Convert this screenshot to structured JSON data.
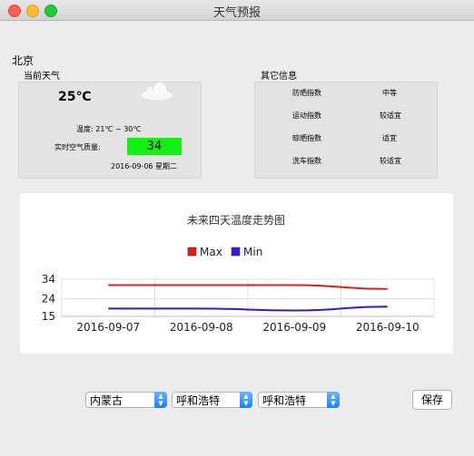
{
  "window": {
    "title": "天气预报"
  },
  "city": "北京",
  "current": {
    "label": "当前天气",
    "temp": "25℃",
    "range": "温度: 21℃ ~ 30℃",
    "aqi_label": "实时空气质量:",
    "aqi_value": "34",
    "date": "2016-09-06  星期二",
    "weather_icon": "cloud-icon"
  },
  "other": {
    "label": "其它信息",
    "items": [
      {
        "name": "防晒指数",
        "value": "中等"
      },
      {
        "name": "运动指数",
        "value": "较适宜"
      },
      {
        "name": "晾晒指数",
        "value": "适宜"
      },
      {
        "name": "洗车指数",
        "value": "较适宜"
      }
    ]
  },
  "chart_data": {
    "type": "line",
    "title": "未来四天温度走势图",
    "categories": [
      "2016-09-07",
      "2016-09-08",
      "2016-09-09",
      "2016-09-10"
    ],
    "series": [
      {
        "name": "Max",
        "color": "#e31a1c",
        "values": [
          31,
          31,
          31,
          29
        ]
      },
      {
        "name": "Min",
        "color": "#3f14d8",
        "values": [
          19,
          19,
          18,
          20
        ]
      }
    ],
    "yticks": [
      "34",
      "24",
      "15"
    ],
    "ylim": [
      15,
      34
    ],
    "grid": true,
    "legend": "top"
  },
  "controls": {
    "province": "内蒙古",
    "city": "呼和浩特",
    "district": "呼和浩特",
    "save_label": "保存"
  },
  "colors": {
    "aqi_good": "#14f014"
  }
}
